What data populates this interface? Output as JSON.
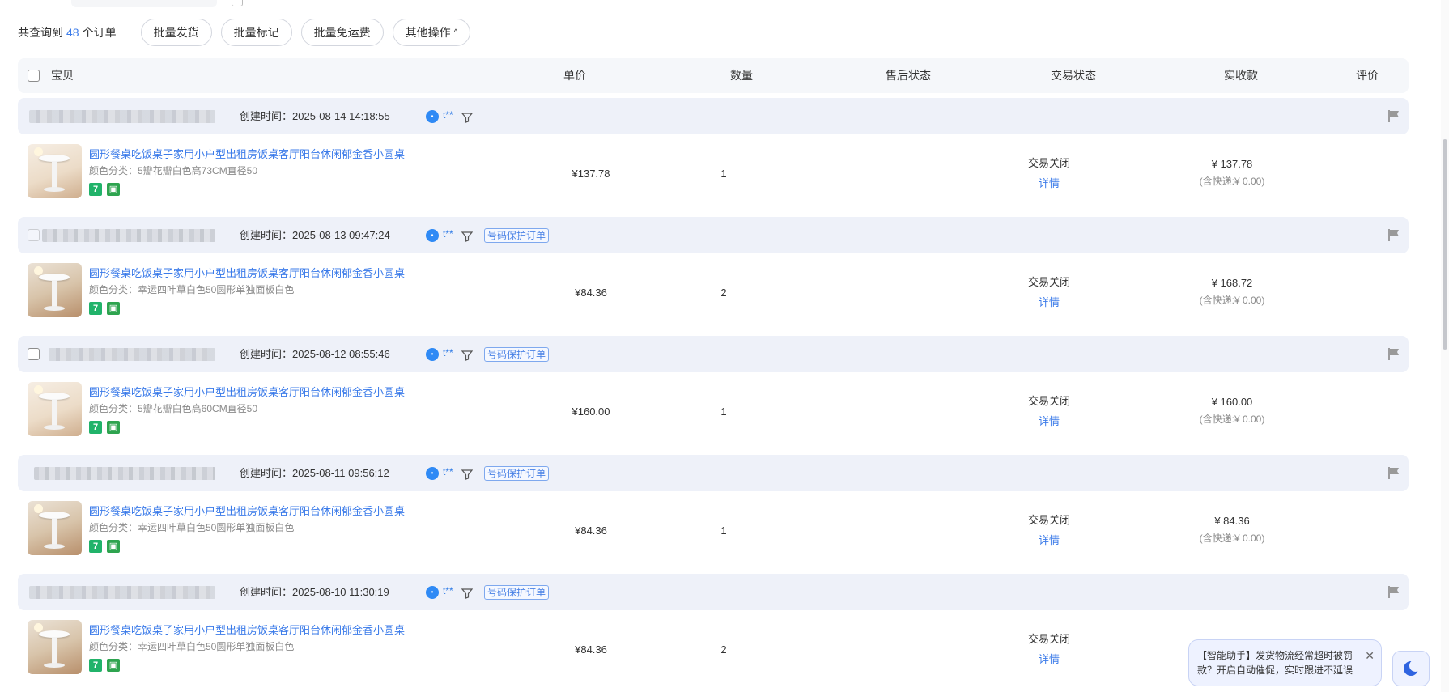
{
  "toolbar": {
    "summary_prefix": "共查询到",
    "summary_count": "48",
    "summary_suffix": "个订单",
    "buttons": [
      {
        "label": "批量发货"
      },
      {
        "label": "批量标记"
      },
      {
        "label": "批量免运费"
      },
      {
        "label": "其他操作"
      }
    ]
  },
  "table_header": {
    "item": "宝贝",
    "unit_price": "单价",
    "quantity": "数量",
    "after_sale": "售后状态",
    "trade_status": "交易状态",
    "received": "实收款",
    "review": "评价"
  },
  "orders": [
    {
      "created": "创建时间：2025-08-14 14:18:55",
      "buyer": "t**",
      "tag": "",
      "product_name": "圆形餐桌吃饭桌子家用小户型出租房饭桌客厅阳台休闲郁金香小圆桌",
      "sku": "颜色分类：5瓣花瓣白色高73CM直径50",
      "price": "¥137.78",
      "qty": "1",
      "status": "交易关闭",
      "detail": "详情",
      "paid": "¥ 137.78",
      "shipping": "(含快递:¥ 0.00)"
    },
    {
      "created": "创建时间：2025-08-13 09:47:24",
      "buyer": "t**",
      "tag": "号码保护订单",
      "product_name": "圆形餐桌吃饭桌子家用小户型出租房饭桌客厅阳台休闲郁金香小圆桌",
      "sku": "颜色分类：幸运四叶草白色50圆形单独面板白色",
      "price": "¥84.36",
      "qty": "2",
      "status": "交易关闭",
      "detail": "详情",
      "paid": "¥ 168.72",
      "shipping": "(含快递:¥ 0.00)"
    },
    {
      "created": "创建时间：2025-08-12 08:55:46",
      "buyer": "t**",
      "tag": "号码保护订单",
      "product_name": "圆形餐桌吃饭桌子家用小户型出租房饭桌客厅阳台休闲郁金香小圆桌",
      "sku": "颜色分类：5瓣花瓣白色高60CM直径50",
      "price": "¥160.00",
      "qty": "1",
      "status": "交易关闭",
      "detail": "详情",
      "paid": "¥ 160.00",
      "shipping": "(含快递:¥ 0.00)"
    },
    {
      "created": "创建时间：2025-08-11 09:56:12",
      "buyer": "t**",
      "tag": "号码保护订单",
      "product_name": "圆形餐桌吃饭桌子家用小户型出租房饭桌客厅阳台休闲郁金香小圆桌",
      "sku": "颜色分类：幸运四叶草白色50圆形单独面板白色",
      "price": "¥84.36",
      "qty": "1",
      "status": "交易关闭",
      "detail": "详情",
      "paid": "¥ 84.36",
      "shipping": "(含快递:¥ 0.00)"
    },
    {
      "created": "创建时间：2025-08-10 11:30:19",
      "buyer": "t**",
      "tag": "号码保护订单",
      "product_name": "圆形餐桌吃饭桌子家用小户型出租房饭桌客厅阳台休闲郁金香小圆桌",
      "sku": "颜色分类：幸运四叶草白色50圆形单独面板白色",
      "price": "¥84.36",
      "qty": "2",
      "status": "交易关闭",
      "detail": "详情",
      "paid": "",
      "shipping": ""
    }
  ],
  "assistant": {
    "message": "【智能助手】发货物流经常超时被罚款？开启自动催促，实时跟进不延误",
    "close_glyph": "✕"
  },
  "colors": {
    "accent": "#3b7be9",
    "row_header_bg": "#eef1f9",
    "table_header_bg": "#f5f7fa"
  }
}
